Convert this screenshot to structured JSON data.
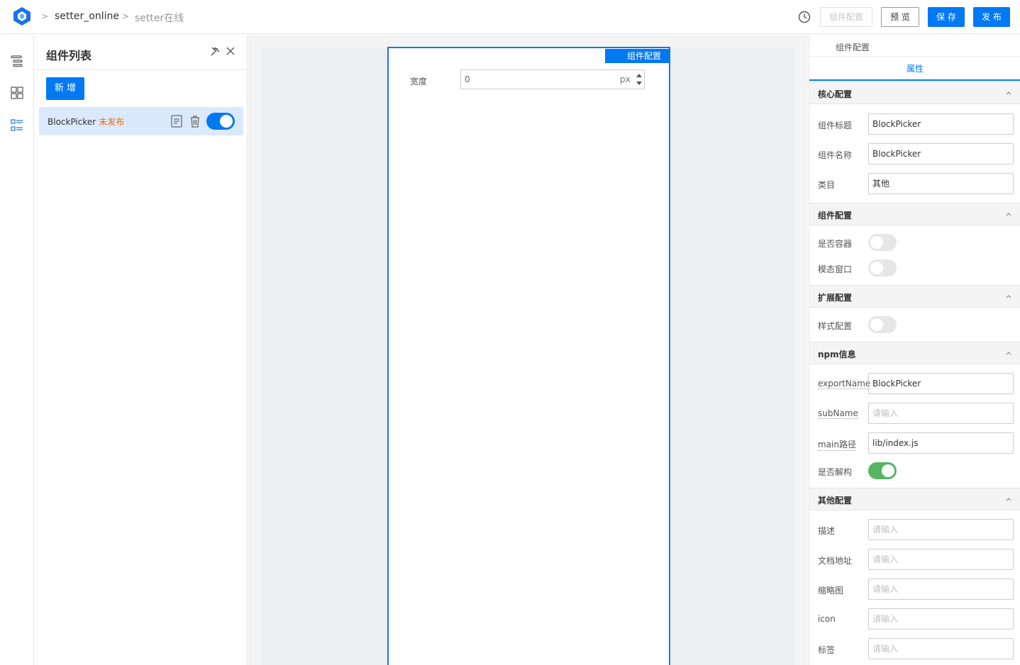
{
  "header": {
    "breadcrumb": [
      "setter_online",
      "setter在线"
    ],
    "buttons": {
      "config": "组件配置",
      "preview": "预 览",
      "save": "保 存",
      "publish": "发 布"
    },
    "accent": "#0079f2"
  },
  "left_rail": {
    "icons": [
      "outline-tree-icon",
      "components-grid-icon",
      "component-list-icon"
    ]
  },
  "panel": {
    "title": "组件列表",
    "add_label": "新 增",
    "items": [
      {
        "name": "BlockPicker",
        "status": "未发布",
        "enabled": true
      }
    ]
  },
  "canvas": {
    "tag": "组件配置",
    "width_label": "宽度",
    "width_value": "0",
    "width_unit": "px"
  },
  "right": {
    "header": "组件配置",
    "tab": "属性",
    "sections": {
      "core": {
        "title": "核心配置",
        "title_label": "组件标题",
        "title_value": "BlockPicker",
        "name_label": "组件名称",
        "name_value": "BlockPicker",
        "category_label": "类目",
        "category_value": "其他"
      },
      "component": {
        "title": "组件配置",
        "container_label": "是否容器",
        "container_on": false,
        "modal_label": "模态窗口",
        "modal_on": false
      },
      "extension": {
        "title": "扩展配置",
        "style_label": "样式配置",
        "style_on": false
      },
      "npm": {
        "title": "npm信息",
        "export_label": "exportName",
        "export_value": "BlockPicker",
        "sub_label": "subName",
        "sub_placeholder": "请输入",
        "main_label": "main路径",
        "main_value": "lib/index.js",
        "destructure_label": "是否解构",
        "destructure_on": true
      },
      "other": {
        "title": "其他配置",
        "desc_label": "描述",
        "desc_placeholder": "请输入",
        "doc_label": "文档地址",
        "doc_placeholder": "请输入",
        "thumb_label": "缩略图",
        "thumb_placeholder": "请输入",
        "icon_label": "icon",
        "icon_placeholder": "请输入",
        "tag_label": "标签",
        "tag_placeholder": "请输入"
      }
    }
  }
}
